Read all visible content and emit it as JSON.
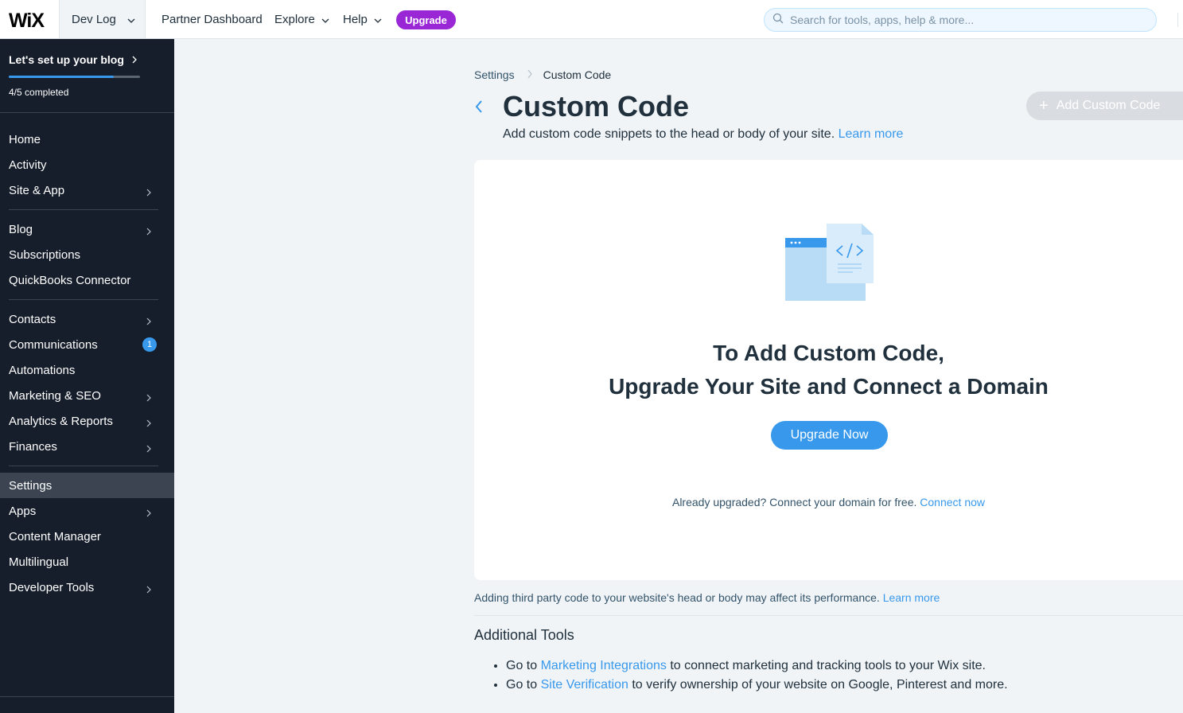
{
  "topbar": {
    "logo": "WiX",
    "site_name": "Dev Log",
    "nav": {
      "partner_dashboard": "Partner Dashboard",
      "explore": "Explore",
      "help": "Help"
    },
    "upgrade_label": "Upgrade",
    "search_placeholder": "Search for tools, apps, help & more..."
  },
  "sidebar": {
    "setup_title": "Let's set up your blog",
    "progress_fraction": 0.8,
    "progress_text": "4/5 completed",
    "items": [
      {
        "label": "Home"
      },
      {
        "label": "Activity"
      },
      {
        "label": "Site & App",
        "has_submenu": true
      },
      {
        "label": "Blog",
        "has_submenu": true
      },
      {
        "label": "Subscriptions"
      },
      {
        "label": "QuickBooks Connector"
      },
      {
        "label": "Contacts",
        "has_submenu": true
      },
      {
        "label": "Communications",
        "badge": "1"
      },
      {
        "label": "Automations"
      },
      {
        "label": "Marketing & SEO",
        "has_submenu": true
      },
      {
        "label": "Analytics & Reports",
        "has_submenu": true
      },
      {
        "label": "Finances",
        "has_submenu": true
      },
      {
        "label": "Settings",
        "active": true
      },
      {
        "label": "Apps",
        "has_submenu": true
      },
      {
        "label": "Content Manager"
      },
      {
        "label": "Multilingual"
      },
      {
        "label": "Developer Tools",
        "has_submenu": true
      }
    ]
  },
  "breadcrumb": {
    "parent": "Settings",
    "current": "Custom Code"
  },
  "page": {
    "title": "Custom Code",
    "subtitle": "Add custom code snippets to the head or body of your site.",
    "subtitle_link": "Learn more",
    "add_button": "Add Custom Code"
  },
  "card": {
    "title_line1": "To Add Custom Code,",
    "title_line2": "Upgrade Your Site and Connect a Domain",
    "upgrade_button": "Upgrade Now",
    "footer_text": "Already upgraded? Connect your domain for free.",
    "footer_link": "Connect now"
  },
  "performance_note": {
    "text": "Adding third party code to your website's head or body may affect its performance.",
    "link": "Learn more"
  },
  "additional_tools": {
    "title": "Additional Tools",
    "items": [
      {
        "prefix": "Go to",
        "link": "Marketing Integrations",
        "suffix": "to connect marketing and tracking tools to your Wix site."
      },
      {
        "prefix": "Go to",
        "link": "Site Verification",
        "suffix": "to verify ownership of your website on Google, Pinterest and more."
      }
    ]
  },
  "colors": {
    "accent": "#3899ec",
    "upgrade_purple": "#9a27d5",
    "sidebar_bg": "#161d2b",
    "page_bg": "#f0f4f7"
  }
}
